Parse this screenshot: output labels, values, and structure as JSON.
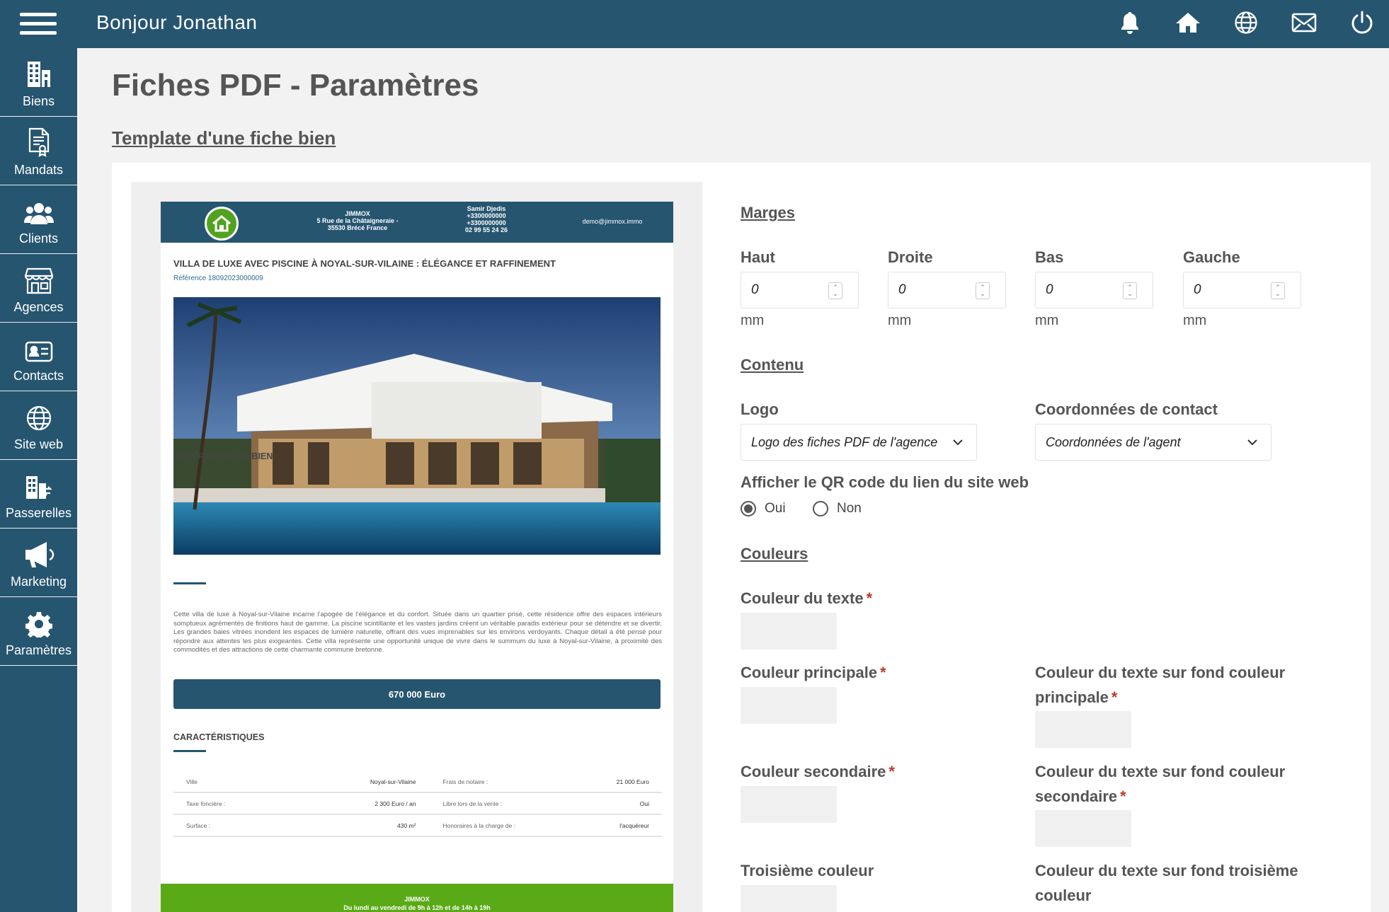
{
  "header": {
    "greeting": "Bonjour Jonathan",
    "icons": [
      "bell-icon",
      "home-icon",
      "globe-icon",
      "mail-icon",
      "power-icon"
    ]
  },
  "sidebar": {
    "items": [
      {
        "label": "Biens",
        "icon": "buildings-icon"
      },
      {
        "label": "Mandats",
        "icon": "document-certificate-icon"
      },
      {
        "label": "Clients",
        "icon": "users-icon"
      },
      {
        "label": "Agences",
        "icon": "storefront-icon"
      },
      {
        "label": "Contacts",
        "icon": "contact-card-icon"
      },
      {
        "label": "Site web",
        "icon": "globe-icon"
      },
      {
        "label": "Passerelles",
        "icon": "buildings-transfer-icon"
      },
      {
        "label": "Marketing",
        "icon": "megaphone-icon"
      },
      {
        "label": "Paramètres",
        "icon": "gear-icon"
      }
    ]
  },
  "main": {
    "title": "Fiches PDF - Paramètres",
    "section_link": "Template d'une fiche bien"
  },
  "preview": {
    "agency_name": "JIMMOX",
    "agency_address_1": "5 Rue de la Châtaigneraie -",
    "agency_address_2": "35530 Brécé France",
    "agent_name": "Samir Djedis",
    "agent_phone_1": "+3300000000",
    "agent_phone_2": "+3300000000",
    "agent_phone_3": "02 99 55 24 26",
    "email": "demo@jimmox.immo",
    "property_title": "VILLA DE LUXE AVEC PISCINE À NOYAL-SUR-VILAINE : ÉLÉGANCE ET RAFFINEMENT",
    "reference": "Référence 18092023000009",
    "description_heading": "DESCRIPTION DU BIEN",
    "description": "Cette villa de luxe à Noyal-sur-Vilaine incarne l'apogée de l'élégance et du confort. Située dans un quartier prisé, cette résidence offre des espaces intérieurs somptueux agrémentés de finitions haut de gamme. La piscine scintillante et les vastes jardins créent un véritable paradis extérieur pour se détendre et se divertir. Les grandes baies vitrées inondent les espaces de lumière naturelle, offrant des vues imprenables sur les environs verdoyants. Chaque détail a été pensé pour répondre aux attentes les plus exigeantes. Cette villa représente une opportunité unique de vivre dans le summum du luxe à Noyal-sur-Vilaine, à proximité des commodités et des attractions de cette charmante commune bretonne.",
    "price": "670 000 Euro",
    "characteristics_heading": "CARACTÉRISTIQUES",
    "characteristics": [
      {
        "k1": "Ville",
        "v1": "Noyal-sur-Vilaine",
        "k2": "Frais de notaire :",
        "v2": "21 000 Euro"
      },
      {
        "k1": "Taxe foncière :",
        "v1": "2 300 Euro / an",
        "k2": "Libre lors de la vente :",
        "v2": "Oui"
      },
      {
        "k1": "Surface :",
        "v1": "430 m²",
        "k2": "Honoraires à la charge de :",
        "v2": "l'acquéreur"
      }
    ],
    "footer_name": "JIMMOX",
    "footer_hours": "Du lundi au vendredi de 9h à 12h et de 14h à 19h"
  },
  "form": {
    "margins_heading": "Marges",
    "margins": [
      {
        "label": "Haut",
        "value": "0",
        "unit": "mm"
      },
      {
        "label": "Droite",
        "value": "0",
        "unit": "mm"
      },
      {
        "label": "Bas",
        "value": "0",
        "unit": "mm"
      },
      {
        "label": "Gauche",
        "value": "0",
        "unit": "mm"
      }
    ],
    "content_heading": "Contenu",
    "logo_label": "Logo",
    "logo_value": "Logo des fiches PDF de l'agence",
    "contact_label": "Coordonnées de contact",
    "contact_value": "Coordonnées de l'agent",
    "qr_label": "Afficher le QR code du lien du site web",
    "qr_yes": "Oui",
    "qr_no": "Non",
    "colors_heading": "Couleurs",
    "text_color": "Couleur du texte",
    "main_color": "Couleur principale",
    "text_on_main_1": "Couleur du texte sur fond couleur",
    "text_on_main_2": "principale",
    "secondary_color": "Couleur secondaire",
    "text_on_secondary_1": "Couleur du texte sur fond couleur",
    "text_on_secondary_2": "secondaire",
    "third_color": "Troisième couleur",
    "text_on_third_1": "Couleur du texte sur fond troisième",
    "text_on_third_2": "couleur",
    "required_mark": "*"
  },
  "colors": {
    "brand": "#265570",
    "accent_green": "#5aaa17",
    "required": "#c0392b"
  }
}
